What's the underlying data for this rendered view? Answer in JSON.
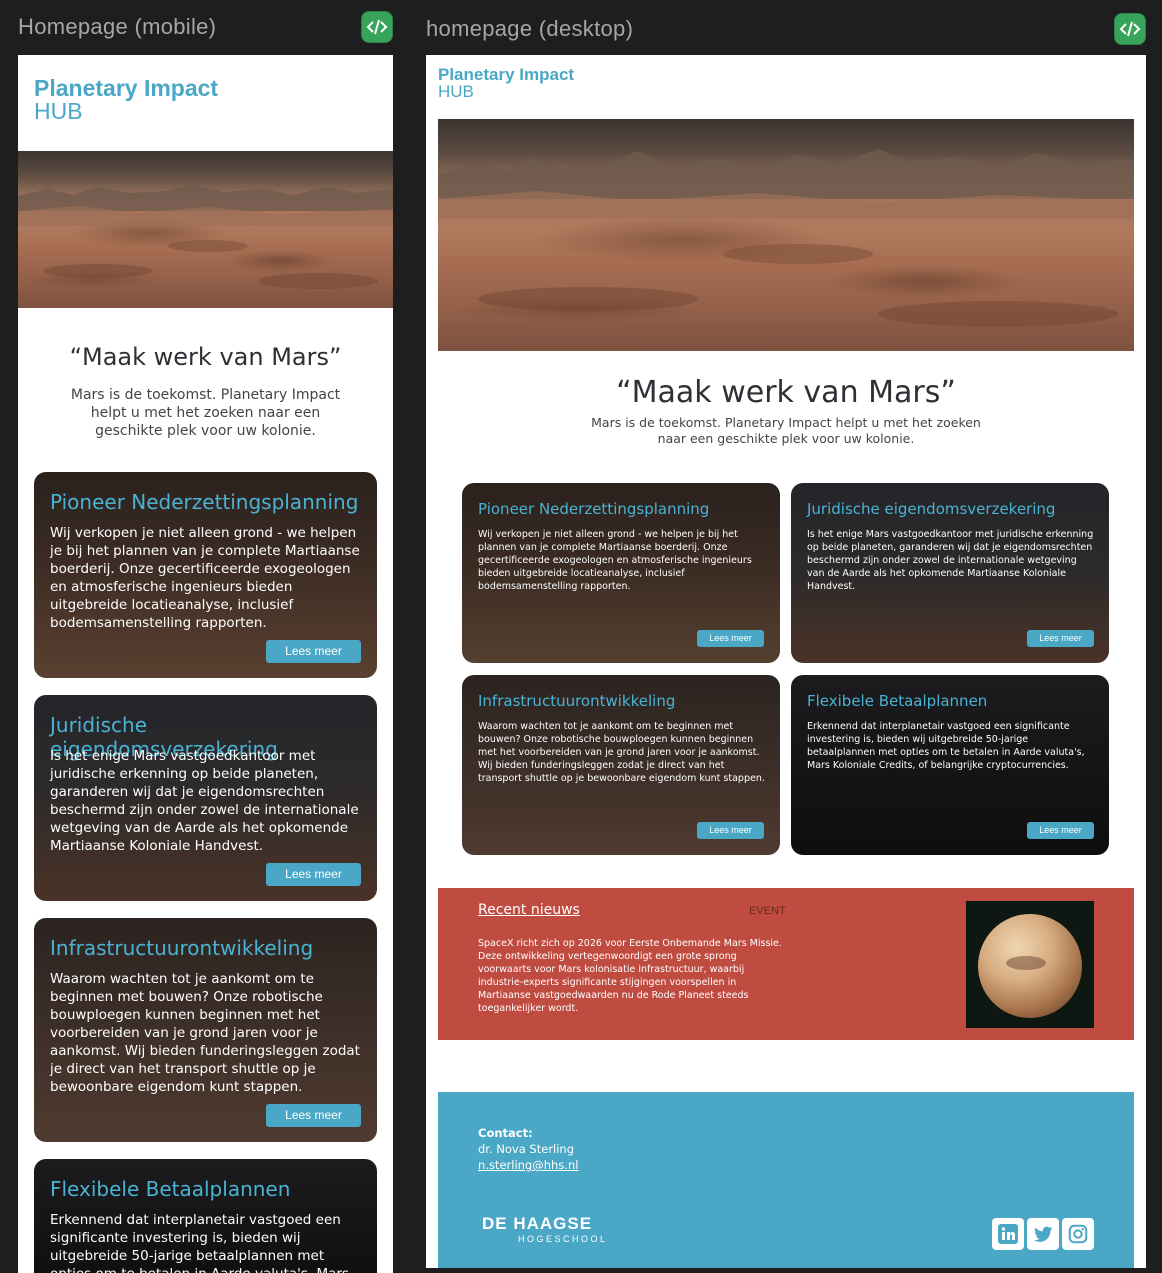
{
  "frames": {
    "mobile_title": "Homepage (mobile)",
    "desktop_title": "homepage (desktop)"
  },
  "icons": {
    "code": "code-icon",
    "linkedin": "linkedin-icon",
    "twitter": "twitter-icon",
    "instagram": "instagram-icon"
  },
  "colors": {
    "accent": "#4aa7c6",
    "news_bg": "#c04b40",
    "code_btn": "#38a35a"
  },
  "logo": {
    "line1": "Planetary Impact",
    "line2": "HUB"
  },
  "hero": {
    "title": "“Maak werk van Mars”",
    "subtitle": "Mars is de toekomst.  Planetary Impact helpt u met het zoeken naar een geschikte plek voor uw kolonie."
  },
  "cards": [
    {
      "title": "Pioneer Nederzettingsplanning",
      "text": "Wij verkopen je niet alleen grond - we helpen je bij het plannen van je complete Martiaanse boerderij. Onze gecertificeerde exogeologen en atmosferische ingenieurs bieden uitgebreide locatieanalyse, inclusief bodemsamenstelling rapporten.",
      "button": "Lees meer"
    },
    {
      "title": "Juridische eigendomsverzekering",
      "text": "Is het enige Mars vastgoedkantoor met juridische erkenning op beide planeten, garanderen wij dat je eigendomsrechten beschermd zijn onder zowel de internationale wetgeving van de Aarde als het opkomende Martiaanse Koloniale Handvest.",
      "button": "Lees meer"
    },
    {
      "title": "Infrastructuurontwikkeling",
      "text": "Waarom wachten tot je aankomt om te beginnen met bouwen? Onze robotische bouwploegen kunnen beginnen met het voorbereiden van je grond jaren voor je aankomst. Wij bieden funderingsleggen zodat je direct van het transport shuttle op je bewoonbare eigendom kunt stappen.",
      "button": "Lees meer"
    },
    {
      "title": "Flexibele Betaalplannen",
      "text": "Erkennend dat interplanetair vastgoed een significante investering is, bieden wij uitgebreide 50-jarige betaalplannen met opties om te betalen in Aarde valuta's, Mars Koloniale Credits, of belangrijke cryptocurrencies.",
      "button": "Lees meer"
    }
  ],
  "mobile_partial_card4_text": "Erkennend dat interplanetair vastgoed een significante investering is, bieden wij uitgebreide 50-jarige betaalplannen met opties om te betalen in Aarde valuta's, Mars",
  "news": {
    "heading": "Recent nieuws",
    "tag": "EVENT",
    "text": "SpaceX richt zich op 2026 voor Eerste Onbemande Mars Missie. Deze ontwikkeling vertegenwoordigt een grote sprong voorwaarts voor Mars kolonisatie infrastructuur, waarbij industrie-experts significante stijgingen voorspellen in Martiaanse vastgoedwaarden nu de Rode Planeet steeds toegankelijker wordt."
  },
  "footer": {
    "contact_label": "Contact:",
    "name": "dr. Nova Sterling",
    "email": "n.sterling@hhs.nl",
    "school_line1": "DE HAAGSE",
    "school_line2": "HOGESCHOOL"
  }
}
